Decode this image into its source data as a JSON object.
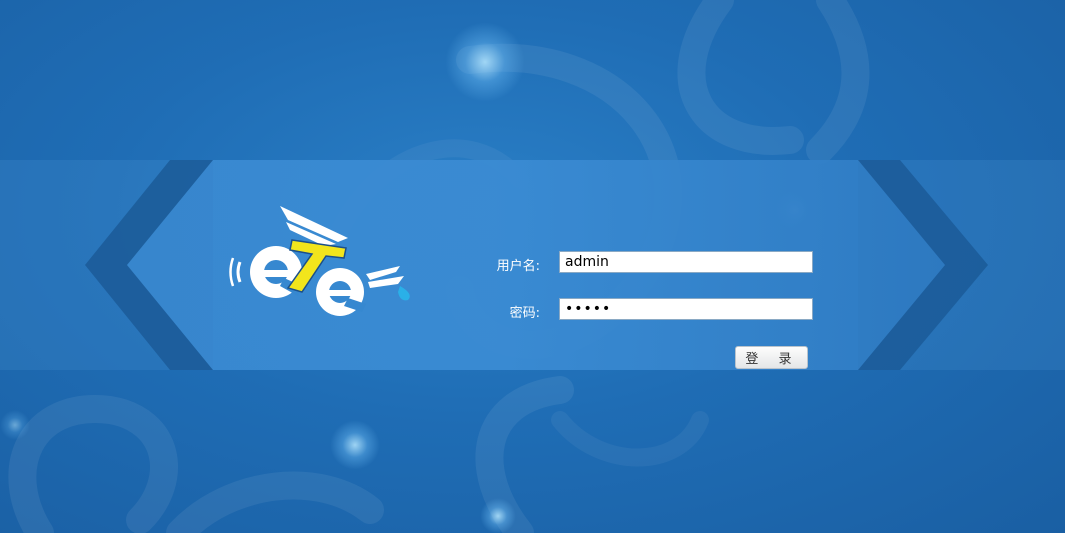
{
  "login": {
    "username_label": "用户名:",
    "username_value": "admin",
    "password_label": "密码:",
    "password_value": "•••••",
    "submit_label": "登 录"
  },
  "logo": {
    "icon": "cyclist-logo-icon"
  },
  "colors": {
    "background": "#1f6db5",
    "band": "#3889d2",
    "chevron_dark": "#1a5896",
    "logo_yellow": "#f2e51c"
  }
}
